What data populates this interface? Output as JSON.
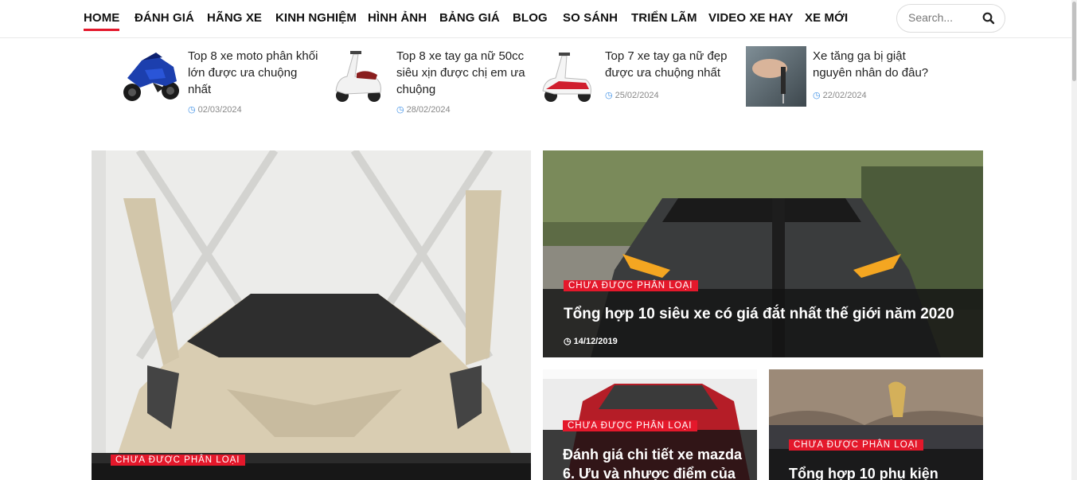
{
  "nav": {
    "items": [
      {
        "label": "HOME",
        "active": true
      },
      {
        "label": "ĐÁNH GIÁ"
      },
      {
        "label": "HÃNG XE"
      },
      {
        "label": "KINH NGHIỆM"
      },
      {
        "label": "HÌNH ẢNH"
      },
      {
        "label": "BẢNG GIÁ"
      },
      {
        "label": "BLOG"
      },
      {
        "label": "SO SÁNH"
      },
      {
        "label": "TRIỂN LÃM"
      },
      {
        "label": "VIDEO XE HAY"
      },
      {
        "label": "XE MỚI"
      }
    ],
    "search_placeholder": "Search...",
    "accent": "#e4182b"
  },
  "trending": [
    {
      "title": "Top 8 xe moto phân khối lớn được ưa chuộng nhất",
      "date": "02/03/2024",
      "thumb_icon": "motorbike-thumbnail"
    },
    {
      "title": "Top 8 xe tay ga nữ 50cc siêu xịn được chị em ưa chuộng",
      "date": "28/02/2024",
      "thumb_icon": "scooter-thumbnail"
    },
    {
      "title": "Top 7 xe tay ga nữ đẹp được ưa chuộng nhất",
      "date": "25/02/2024",
      "thumb_icon": "scooter-thumbnail"
    },
    {
      "title": "Xe tăng ga bị giật nguyên nhân do đâu?",
      "date": "22/02/2024",
      "thumb_icon": "key-thumbnail"
    }
  ],
  "featured": {
    "main": {
      "category": "CHƯA ĐƯỢC PHÂN LOẠI"
    },
    "top_right": {
      "category": "CHƯA ĐƯỢC PHÂN LOẠI",
      "title": "Tổng hợp 10 siêu xe có giá đắt nhất thế giới năm 2020",
      "date": "14/12/2019"
    },
    "bottom_left": {
      "category": "CHƯA ĐƯỢC PHÂN LOẠI",
      "title": "Đánh giá chi tiết xe mazda 6. Ưu và nhược điểm của"
    },
    "bottom_right": {
      "category": "CHƯA ĐƯỢC PHÂN LOẠI",
      "title": "Tổng hợp 10 phụ kiện"
    }
  }
}
